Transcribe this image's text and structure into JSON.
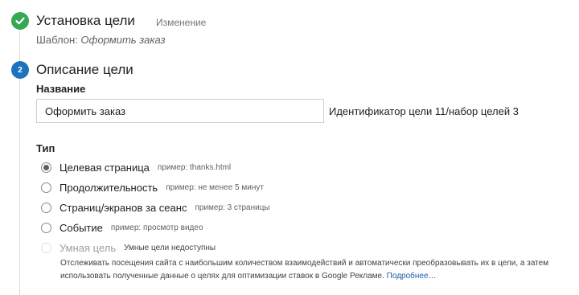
{
  "step1": {
    "title": "Установка цели",
    "edit_label": "Изменение",
    "template_label": "Шаблон:",
    "template_value": "Оформить заказ"
  },
  "step2": {
    "number": "2",
    "title": "Описание цели",
    "name_label": "Название",
    "name_value": "Оформить заказ",
    "goal_id": "Идентификатор цели 11/набор целей 3",
    "type_label": "Тип",
    "types": [
      {
        "label": "Целевая страница",
        "hint": "пример: thanks.html",
        "checked": true
      },
      {
        "label": "Продолжительность",
        "hint": "пример: не менее 5 минут",
        "checked": false
      },
      {
        "label": "Страниц/экранов за сеанс",
        "hint": "пример: 3 страницы",
        "checked": false
      },
      {
        "label": "Событие",
        "hint": "пример: просмотр видео",
        "checked": false
      },
      {
        "label": "Умная цель",
        "hint": "Умные цели недоступны",
        "checked": false,
        "disabled": true
      }
    ],
    "smart_description": "Отслеживать посещения сайта с наибольшим количеством взаимодействий и автоматически преобразовывать их в цели, а затем использовать полученные данные о целях для оптимизации ставок в Google Рекламе.",
    "more_link": "Подробнее…"
  },
  "colors": {
    "step_done": "#34a853",
    "step_active": "#1e73be",
    "link": "#1a5fa6"
  },
  "icons": {
    "step1": "check-icon"
  }
}
